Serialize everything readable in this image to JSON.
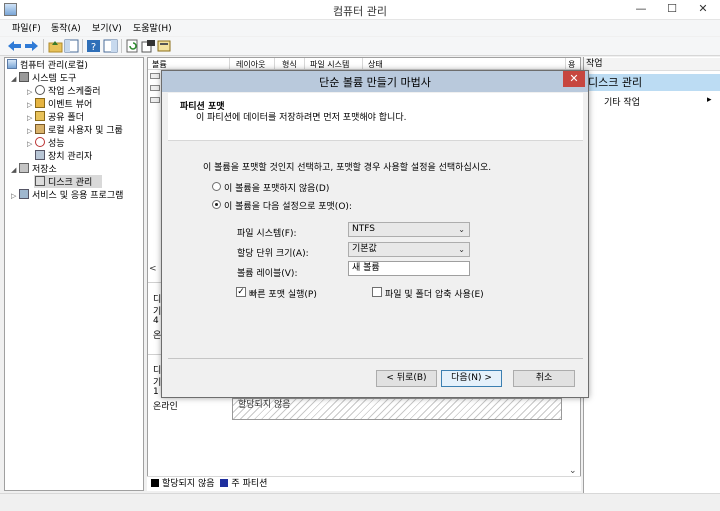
{
  "window": {
    "title": "컴퓨터 관리",
    "min": "—",
    "max": "☐",
    "close": "✕"
  },
  "menubar": [
    "파일(F)",
    "동작(A)",
    "보기(V)",
    "도움말(H)"
  ],
  "tree": {
    "root": "컴퓨터 관리(로컬)",
    "system_tools": "시스템 도구",
    "task_scheduler": "작업 스케줄러",
    "event_viewer": "이벤트 뷰어",
    "shared_folders": "공유 폴더",
    "local_users": "로컬 사용자 및 그룹",
    "performance": "성능",
    "device_manager": "장치 관리자",
    "storage": "저장소",
    "disk_management": "디스크 관리",
    "services_apps": "서비스 및 응용 프로그램"
  },
  "columns": [
    "볼륨",
    "레이아웃",
    "형식",
    "파일 시스템",
    "상태",
    "용"
  ],
  "disk_rows_text": {
    "d1a": "디",
    "d1b": "기",
    "d1c": "4",
    "d1d": "온",
    "d2a": "디",
    "d2b": "기",
    "d2c": "1",
    "d2d": "온라인"
  },
  "partition_status": "할당되지 않음",
  "scroll_left": "<",
  "scroll_down": "⌄",
  "scroll_up": "^",
  "statusbar": {
    "unallocated": "할당되지 않음",
    "primary": "주 파티션"
  },
  "actions": {
    "header": "작업",
    "selected": "디스크 관리",
    "more": "기타 작업",
    "arrow": "▸"
  },
  "dialog": {
    "title": "단순 볼륨 만들기 마법사",
    "close": "✕",
    "head_title": "파티션 포맷",
    "head_subtitle": "이 파티션에 데이터를 저장하려면 먼저 포맷해야 합니다.",
    "instruction": "이 볼륨을 포맷할 것인지 선택하고, 포맷할 경우 사용할 설정을 선택하십시오.",
    "radio_no_format": "이 볼륨을 포맷하지 않음(D)",
    "radio_format": "이 볼륨을 다음 설정으로 포맷(O):",
    "fs_label": "파일 시스템(F):",
    "fs_value": "NTFS",
    "alloc_label": "할당 단위 크기(A):",
    "alloc_value": "기본값",
    "vol_label": "볼륨 레이블(V):",
    "vol_value": "새 볼륨",
    "quick_format": "빠른 포맷 실행(P)",
    "quick_format_checked": true,
    "compression": "파일 및 폴더 압축 사용(E)",
    "compression_checked": false,
    "back": "< 뒤로(B)",
    "next": "다음(N) >",
    "cancel": "취소"
  },
  "colors": {
    "dialog_title_bg": "#b9c9dc",
    "close_red": "#c7463f",
    "selection_blue": "#bcdcf3",
    "primary_partition": "#1f2f9e",
    "unallocated": "#000000"
  }
}
